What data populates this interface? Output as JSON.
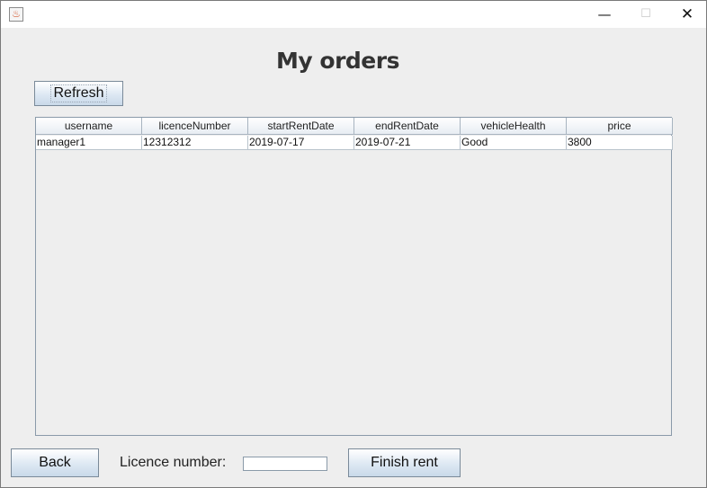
{
  "window": {
    "icon": "java-cup-icon",
    "controls": {
      "minimize": "—",
      "maximize": "☐",
      "close": "✕"
    }
  },
  "page": {
    "title": "My orders"
  },
  "toolbar": {
    "refresh_label": "Refresh"
  },
  "table": {
    "columns": [
      "username",
      "licenceNumber",
      "startRentDate",
      "endRentDate",
      "vehicleHealth",
      "price"
    ],
    "rows": [
      [
        "manager1",
        "12312312",
        "2019-07-17",
        "2019-07-21",
        "Good",
        "3800"
      ]
    ]
  },
  "footer": {
    "back_label": "Back",
    "licence_label": "Licence number:",
    "licence_value": "",
    "finish_label": "Finish rent"
  }
}
